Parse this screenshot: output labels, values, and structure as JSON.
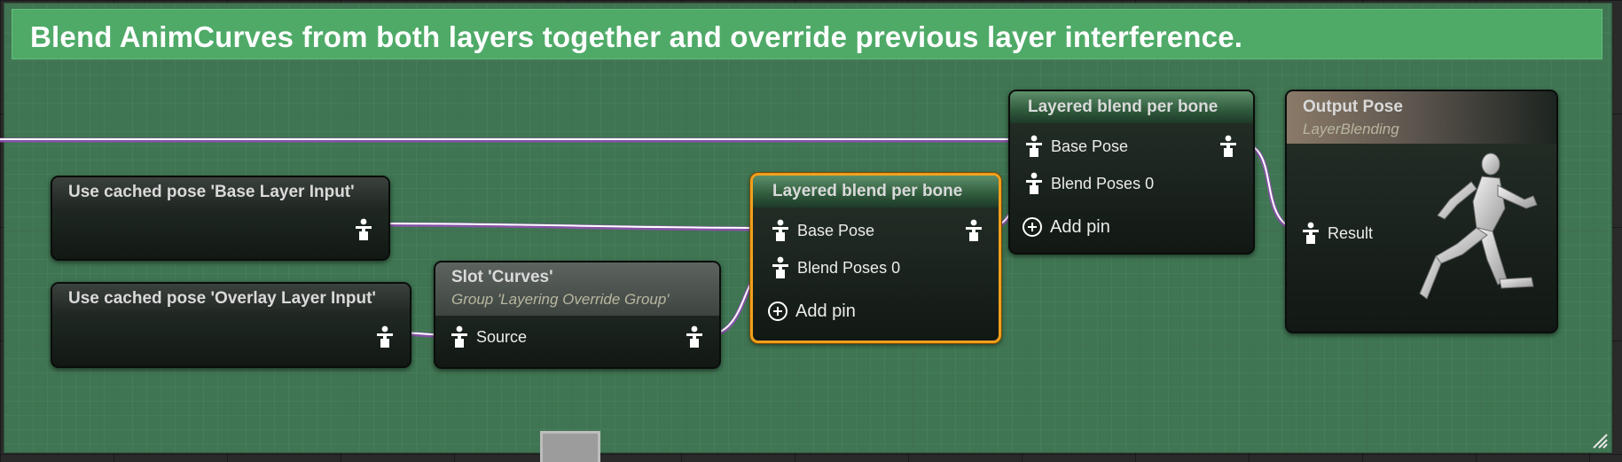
{
  "comment": {
    "title": "Blend AnimCurves from both layers together and override previous layer interference."
  },
  "nodes": {
    "cached_base": {
      "title": "Use cached pose 'Base Layer Input'"
    },
    "cached_overlay": {
      "title": "Use cached pose 'Overlay Layer Input'"
    },
    "slot": {
      "title": "Slot 'Curves'",
      "subtitle": "Group 'Layering Override Group'",
      "input_label": "Source"
    },
    "blend_1": {
      "title": "Layered blend per bone",
      "base_pose_label": "Base Pose",
      "blend_poses_label": "Blend Poses 0",
      "add_pin_label": "Add pin"
    },
    "blend_2": {
      "title": "Layered blend per bone",
      "base_pose_label": "Base Pose",
      "blend_poses_label": "Blend Poses 0",
      "add_pin_label": "Add pin"
    },
    "output": {
      "title": "Output Pose",
      "subtitle": "LayerBlending",
      "result_label": "Result"
    }
  },
  "colors": {
    "comment_background": "#3f7552",
    "comment_header": "#4faa68",
    "selection_outline": "#f0a01e",
    "pose_wire": "#ffffff",
    "pose_wire_glow": "#8e4fb0"
  },
  "icons": {
    "pose_pin": "pose-pin-icon",
    "add_pin": "add-pin-icon",
    "output_preview": "running-mannequin-icon",
    "resize": "resize-grip-icon"
  }
}
